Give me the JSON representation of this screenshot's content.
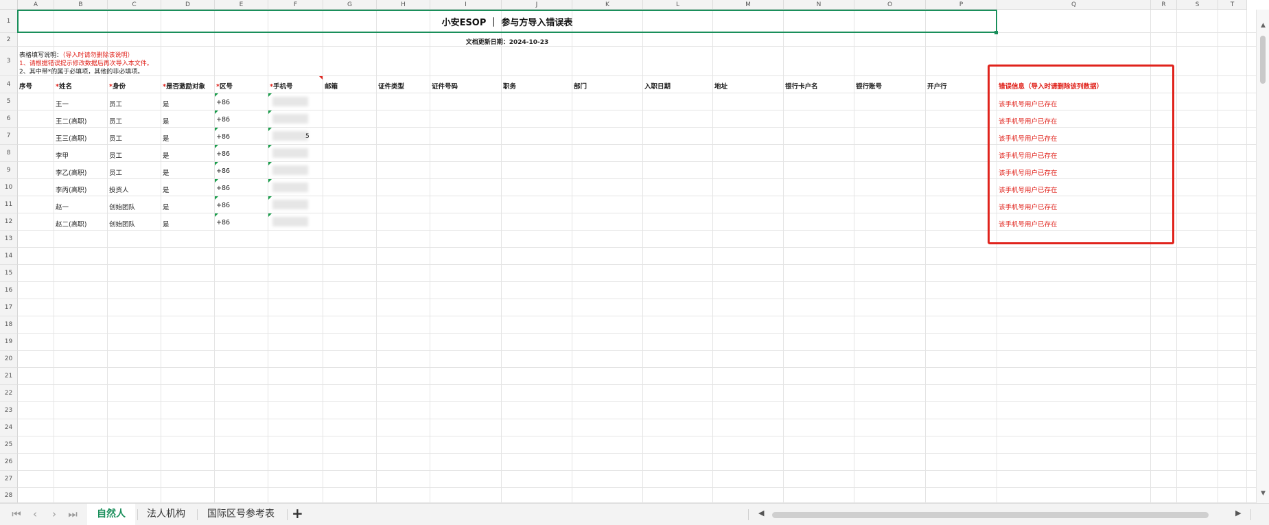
{
  "columns": [
    "A",
    "B",
    "C",
    "D",
    "E",
    "F",
    "G",
    "H",
    "I",
    "J",
    "K",
    "L",
    "M",
    "N",
    "O",
    "P",
    "Q",
    "R",
    "S",
    "T"
  ],
  "rows": [
    "1",
    "2",
    "3",
    "4",
    "5",
    "6",
    "7",
    "8",
    "9",
    "10",
    "11",
    "12",
    "13",
    "14",
    "15",
    "16",
    "17",
    "18",
    "19",
    "20",
    "21",
    "22",
    "23",
    "24",
    "25",
    "26",
    "27",
    "28"
  ],
  "sheet": {
    "title": "小安ESOP ｜ 参与方导入错误表",
    "update_date": "文档更新日期：2024-10-23",
    "notes": {
      "line1_prefix": "表格填写说明：",
      "line1_red": "（导入时请勿删除该说明）",
      "line2": "1、请根据错误提示修改数据后再次导入本文件。",
      "line3": "2、其中带*的属于必填项，其他的非必填项。"
    },
    "headers": [
      "序号",
      "*姓名",
      "*身份",
      "*是否激励对象",
      "*区号",
      "*手机号",
      "邮箱",
      "证件类型",
      "证件号码",
      "职务",
      "部门",
      "入职日期",
      "地址",
      "银行卡户名",
      "银行账号",
      "开户行",
      "错误信息（导入时请删除该列数据）"
    ],
    "data_rows": [
      {
        "name": "王一",
        "role": "员工",
        "incentive": "是",
        "area": "+86",
        "phone_tail": "",
        "error": "该手机号用户已存在"
      },
      {
        "name": "王二(高职)",
        "role": "员工",
        "incentive": "是",
        "area": "+86",
        "phone_tail": "",
        "error": "该手机号用户已存在"
      },
      {
        "name": "王三(高职)",
        "role": "员工",
        "incentive": "是",
        "area": "+86",
        "phone_tail": "5",
        "error": "该手机号用户已存在"
      },
      {
        "name": "李甲",
        "role": "员工",
        "incentive": "是",
        "area": "+86",
        "phone_tail": "",
        "error": "该手机号用户已存在"
      },
      {
        "name": "李乙(高职)",
        "role": "员工",
        "incentive": "是",
        "area": "+86",
        "phone_tail": "",
        "error": "该手机号用户已存在"
      },
      {
        "name": "李丙(高职)",
        "role": "投资人",
        "incentive": "是",
        "area": "+86",
        "phone_tail": "",
        "error": "该手机号用户已存在"
      },
      {
        "name": "赵一",
        "role": "创始团队",
        "incentive": "是",
        "area": "+86",
        "phone_tail": "",
        "error": "该手机号用户已存在"
      },
      {
        "name": "赵二(高职)",
        "role": "创始团队",
        "incentive": "是",
        "area": "+86",
        "phone_tail": "",
        "error": "该手机号用户已存在"
      }
    ]
  },
  "tabs": [
    {
      "label": "自然人",
      "active": true
    },
    {
      "label": "法人机构",
      "active": false
    },
    {
      "label": "国际区号参考表",
      "active": false
    }
  ],
  "icons": {
    "first_sheet": "first-sheet-icon",
    "prev_sheet": "prev-sheet-icon",
    "next_sheet": "next-sheet-icon",
    "last_sheet": "last-sheet-icon",
    "add_sheet": "plus-icon",
    "scroll_left": "arrow-left-icon",
    "scroll_right": "arrow-right-icon"
  },
  "colors": {
    "accent": "#1a8f5b",
    "error": "#e0231c"
  }
}
